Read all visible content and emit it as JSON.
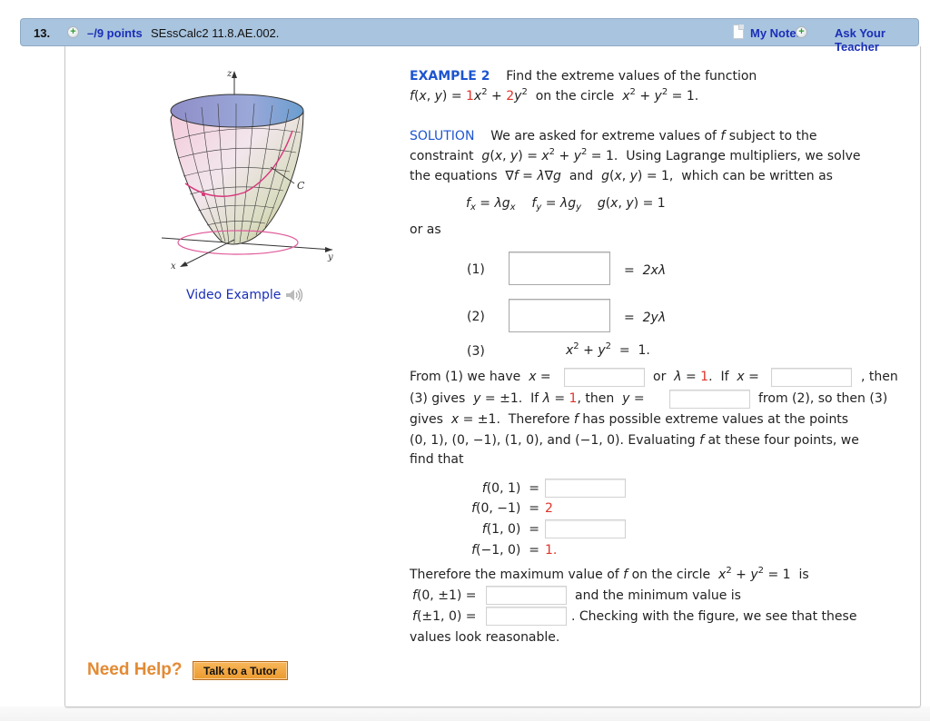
{
  "question": {
    "number": "13.",
    "points": "–/9 points",
    "code": "SEssCalc2 11.8.AE.002.",
    "my_notes": "My Notes",
    "ask_teacher": "Ask Your Teacher"
  },
  "figure": {
    "z_label": "z",
    "x_label": "x",
    "y_label": "y",
    "curve_label": "C",
    "video_link": "Video Example"
  },
  "example": {
    "title": "EXAMPLE 2",
    "intro": "Find the extreme values of the function",
    "coef_x": "1",
    "coef_y": "2",
    "constraint_text": "on the circle"
  },
  "solution": {
    "label": "SOLUTION",
    "line1": "We are asked for extreme values of",
    "line1_end": "subject to the",
    "line2_start": "constraint",
    "line2_end": "Using Lagrange multipliers, we solve",
    "line3_start": "the equations",
    "line3_mid": "and",
    "line3_end": "which can be written as",
    "or_as": "or as"
  },
  "equations": [
    {
      "label": "(1)",
      "rhs": "2xλ",
      "answer": ""
    },
    {
      "label": "(2)",
      "rhs": "2yλ",
      "answer": ""
    },
    {
      "label": "(3)",
      "rhs": "x² + y² = 1."
    }
  ],
  "paragraph": {
    "from1": "From (1) we have",
    "or_lambda": "or",
    "lambda_val": "1",
    "if_x": "If",
    "then": ", then",
    "gives_y": "(3) gives",
    "if_lambda": "If",
    "then_y": ", then",
    "from2": "from (2), so then (3)",
    "gives_x": "gives",
    "therefore": "Therefore",
    "possible": "has possible extreme values at the points",
    "points": "(0, 1), (0, −1), (1, 0), and (−1, 0). Evaluating",
    "evaluating_end": "at these four points, we",
    "find_that": "find that",
    "answers": {
      "x_eq_1": "",
      "x_eq_2": "",
      "y_eq": ""
    }
  },
  "evaluations": [
    {
      "label": "f(0, 1)",
      "value": "",
      "is_input": true
    },
    {
      "label": "f(0, −1)",
      "value": "2",
      "is_input": false
    },
    {
      "label": "f(1, 0)",
      "value": "",
      "is_input": true
    },
    {
      "label": "f(−1, 0)",
      "value": "1.",
      "is_input": false
    }
  ],
  "conclusion": {
    "line1": "Therefore the maximum value of",
    "line1_mid": "on the circle",
    "line1_end": "is",
    "max_label": "f(0, ±1) =",
    "and_min": "and the minimum value is",
    "min_label": "f(±1, 0) =",
    "checking": ". Checking with the figure, we see that these",
    "reasonable": "values look reasonable.",
    "max_value": "",
    "min_value": ""
  },
  "help": {
    "need_help": "Need Help?",
    "tutor_button": "Talk to a Tutor"
  }
}
